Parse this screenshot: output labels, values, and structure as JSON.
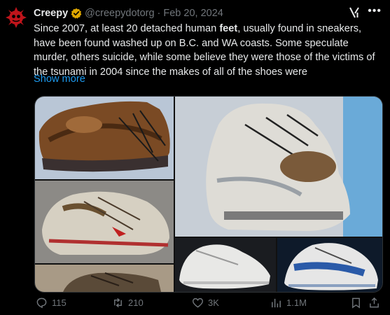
{
  "author": {
    "display_name": "Creepy",
    "handle": "@creepydotorg",
    "separator": "·",
    "date": "Feb 20, 2024",
    "verified_color": "#e0a800"
  },
  "tweet": {
    "text_before": "Since 2007, at least 20 detached human ",
    "text_bold": "feet",
    "text_after": ", usually found in sneakers, have been found washed up on B.C. and WA coasts. Some speculate murder, others suicide, while some believe they were those of the victims of the tsunami in 2004 since the makes of all of the shoes were",
    "show_more": "Show more"
  },
  "media": {
    "images": [
      {
        "icon": "brown-hiking-shoe"
      },
      {
        "icon": "white-gray-sneaker"
      },
      {
        "icon": "worn-white-red-sneaker"
      },
      {
        "icon": "white-sneaker"
      },
      {
        "icon": "blue-white-sneaker"
      },
      {
        "icon": "dark-boot-partial"
      }
    ]
  },
  "actions": {
    "replies": "115",
    "reposts": "210",
    "likes": "3K",
    "views": "1.1M"
  },
  "colors": {
    "background": "#000000",
    "text": "#e7e9ea",
    "muted": "#71767b",
    "link": "#1d9bf0",
    "avatar": "#c0141b"
  }
}
